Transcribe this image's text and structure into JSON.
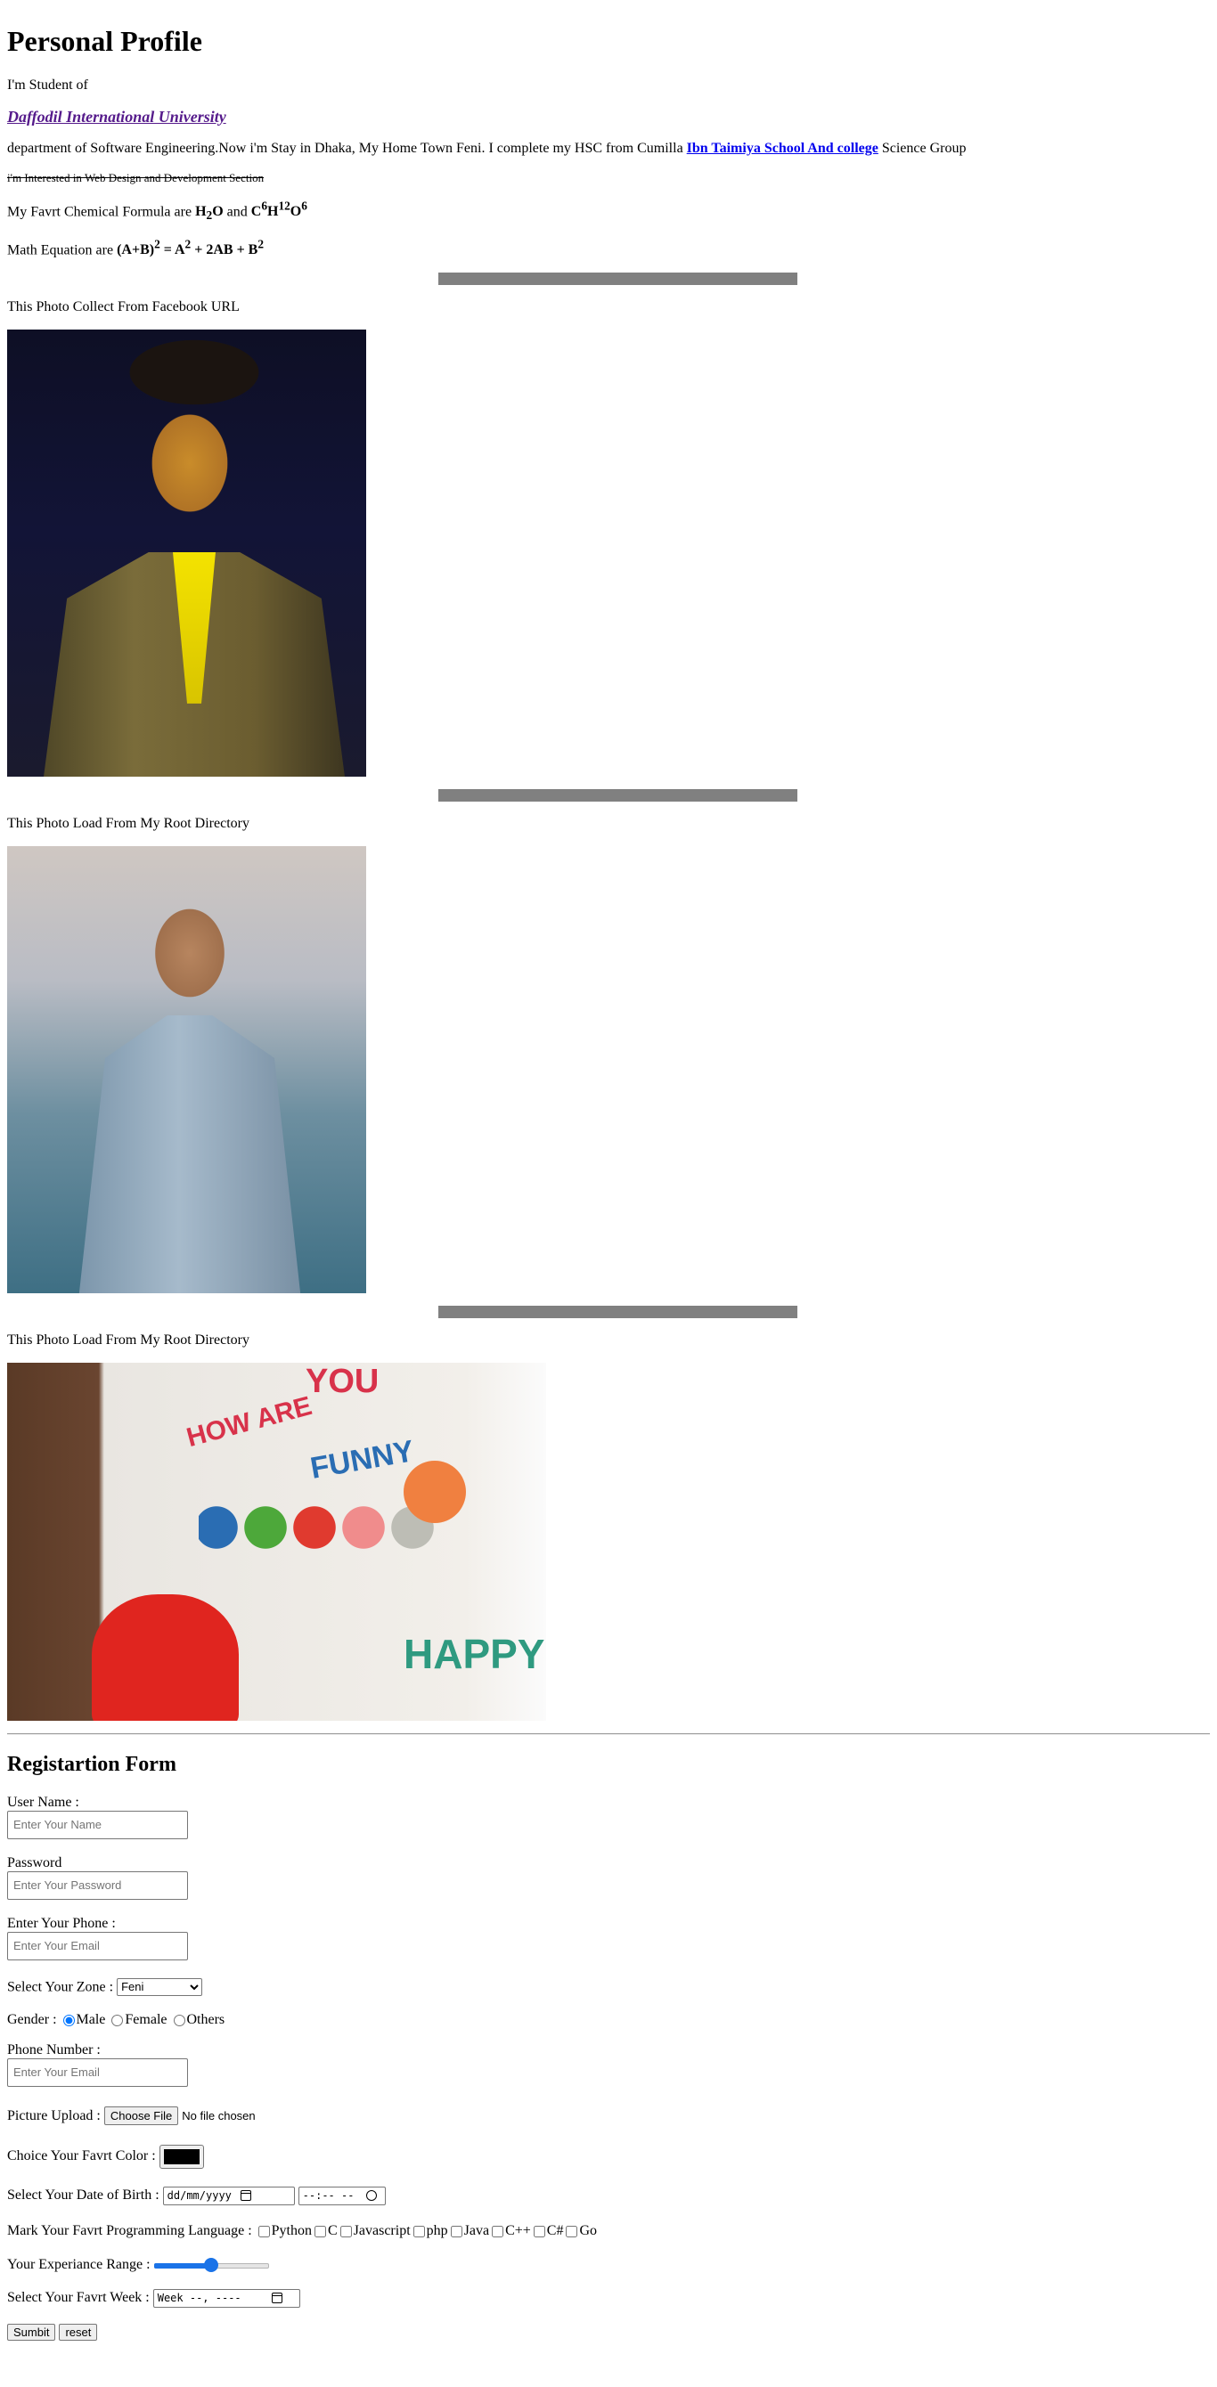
{
  "profile": {
    "title": "Personal Profile",
    "student_of": "I'm Student of",
    "university": "Daffodil International University",
    "bio_before": "department of Software Engineering.Now i'm Stay in Dhaka, My Home Town Feni. I complete my HSC from Cumilla ",
    "school": "Ibn Taimiya School And college",
    "bio_after": " Science Group",
    "interest": "i'm Interested in Web Design and Development Section",
    "chem_prefix": "My Favrt Chemical Formula are ",
    "chem_h": "H",
    "chem_h_sub": "2",
    "chem_o": "O",
    "chem_and": " and ",
    "chem_c": "C",
    "chem_c_sup": "6",
    "chem_h2": "H",
    "chem_h2_sup": "12",
    "chem_o2": "O",
    "chem_o2_sup": "6",
    "math_prefix": "Math Equation are ",
    "math_ab": "(A+B)",
    "math_ab_sup": "2",
    "math_eq": " = A",
    "math_a_sup": "2",
    "math_mid": " + 2AB + B",
    "math_b_sup": "2"
  },
  "photos": [
    {
      "caption": "This Photo Collect From Facebook URL"
    },
    {
      "caption": "This Photo Load From My Root Directory"
    },
    {
      "caption": "This Photo Load From My Root Directory",
      "text_how": "HOW ARE",
      "text_you": "YOU",
      "text_funny": "FUNNY",
      "text_happy": "HAPPY"
    }
  ],
  "form": {
    "title": "Registartion Form",
    "username_label": "User Name :",
    "username_placeholder": "Enter Your Name",
    "password_label": "Password",
    "password_placeholder": "Enter Your Password",
    "phone_label": "Enter Your Phone :",
    "phone_placeholder": "Enter Your Email",
    "zone_label": "Select Your Zone : ",
    "zone_value": "Feni",
    "gender_label": "Gender : ",
    "gender_male": "Male",
    "gender_female": "Female",
    "gender_others": "Others",
    "phone2_label": "Phone Number :",
    "phone2_placeholder": "Enter Your Email",
    "picture_label": "Picture Upload : ",
    "file_button": "Choose File",
    "file_status": "No file chosen",
    "color_label": "Choice Your Favrt Color : ",
    "color_value": "#000000",
    "dob_label": "Select Your Date of Birth : ",
    "dob_placeholder": "dd/mm/yyyy",
    "time_placeholder": "--:-- --",
    "lang_label": "Mark Your Favrt Programming Language : ",
    "languages": [
      "Python",
      "C",
      "Javascript",
      "php",
      "Java",
      "C++",
      "C#",
      "Go"
    ],
    "range_label": "Your Experiance Range : ",
    "range_value": 0.5,
    "week_label": "Select Your Favrt Week : ",
    "week_placeholder": "Week --, ----",
    "submit_label": "Sumbit",
    "reset_label": "reset"
  },
  "colors": {
    "link_visited": "#551a8b",
    "link": "#0000ee",
    "separator": "#808080",
    "accent": "#1a73e8"
  }
}
